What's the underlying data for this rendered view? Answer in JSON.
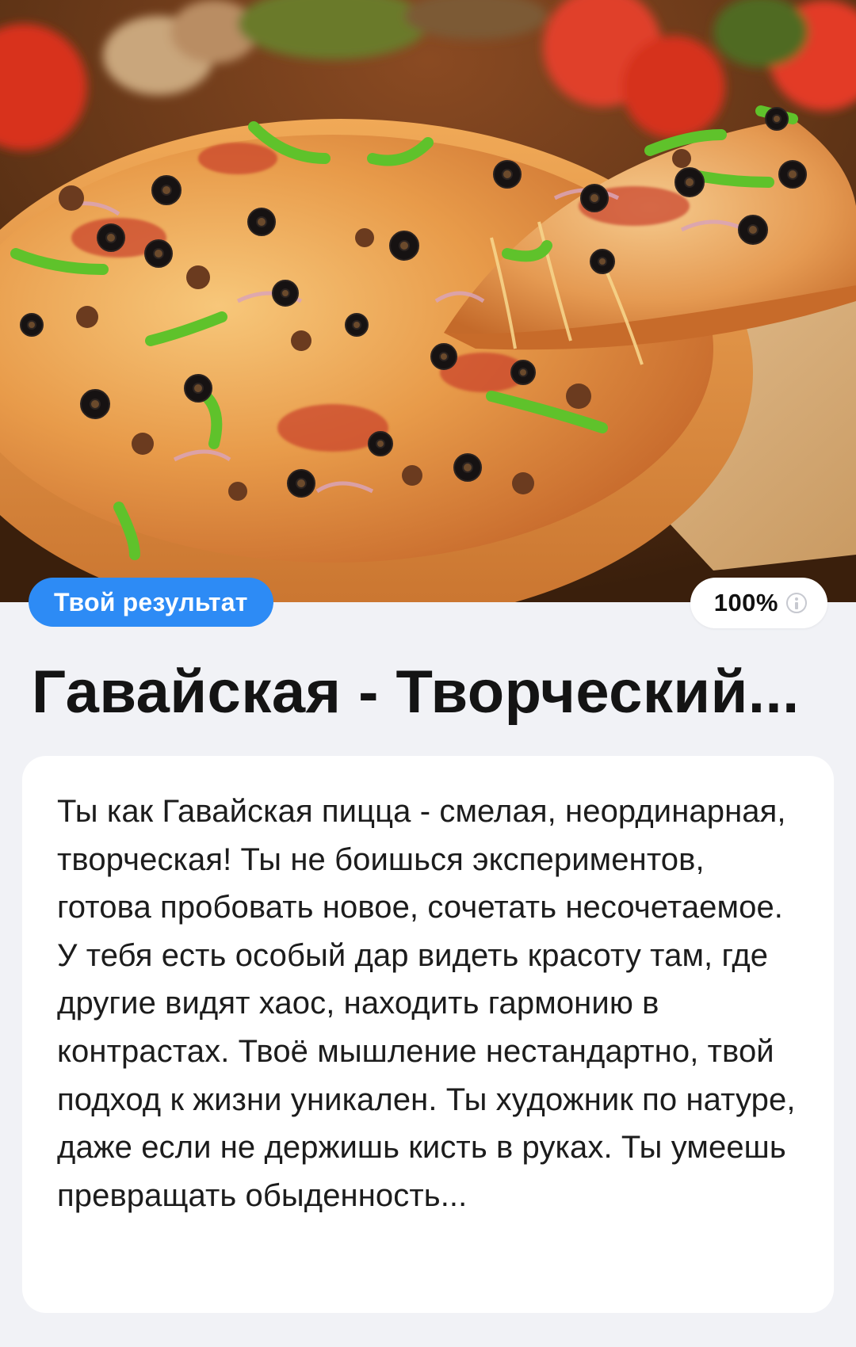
{
  "hero": {
    "image_name": "pizza-photo"
  },
  "result": {
    "badge_label": "Твой результат",
    "match_percent": "100%",
    "title": "Гавайская - Творческий...",
    "description": "Ты как Гавайская пицца - смелая, неординарная, творческая! Ты не боишься экспериментов, готова пробовать новое, сочетать несочетаемое. У тебя есть особый дар видеть красоту там, где другие видят хаос, находить гармонию в контрастах. Твоё мышление нестандартно, твой подход к жизни уникален. Ты художник по натуре, даже если не держишь кисть в руках. Ты умеешь превращать обыденность..."
  },
  "colors": {
    "accent": "#2d8bf5",
    "background": "#f1f2f6",
    "card": "#ffffff",
    "text": "#141414"
  },
  "icons": {
    "info": "info-icon"
  }
}
